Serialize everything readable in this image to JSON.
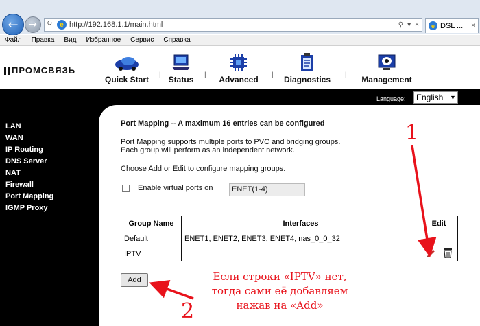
{
  "browser": {
    "url": "http://192.168.1.1/main.html",
    "tab_title": "DSL ...",
    "menu": [
      "Файл",
      "Правка",
      "Вид",
      "Избранное",
      "Сервис",
      "Справка"
    ]
  },
  "router": {
    "logo_text": "ПРОМСВЯЗЬ",
    "nav": [
      "Quick Start",
      "Status",
      "Advanced",
      "Diagnostics",
      "Management"
    ],
    "language_label": "Language:",
    "language_value": "English",
    "sidebar": [
      "LAN",
      "WAN",
      "IP Routing",
      "DNS Server",
      "NAT",
      "Firewall",
      "Port Mapping",
      "IGMP Proxy"
    ]
  },
  "content": {
    "title": "Port Mapping -- A maximum 16 entries can be configured",
    "desc_line1": "Port Mapping supports multiple ports to PVC and bridging groups.",
    "desc_line2": "Each group will perform as an independent network.",
    "choose": "Choose Add or Edit to configure mapping groups.",
    "enable_label": "Enable virtual ports on",
    "virtual_port_value": "ENET(1-4)",
    "table": {
      "headers": [
        "Group Name",
        "Interfaces",
        "Edit"
      ],
      "rows": [
        {
          "group": "Default",
          "interfaces": "ENET1, ENET2, ENET3, ENET4, nas_0_0_32"
        },
        {
          "group": "IPTV",
          "interfaces": ""
        }
      ]
    },
    "add_label": "Add"
  },
  "annotation": {
    "line1": "Если строки «IPTV» нет,",
    "line2": "тогда сами её добавляем",
    "line3": "нажав на «Add»",
    "num1": "1",
    "num2": "2",
    "color": "#e8121b"
  }
}
